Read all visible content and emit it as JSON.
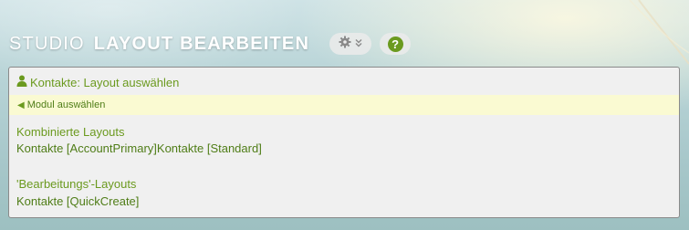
{
  "header": {
    "title_light": "STUDIO",
    "title_bold": "LAYOUT BEARBEITEN",
    "help_label": "?"
  },
  "panel": {
    "title": "Kontakte: Layout auswählen",
    "back_label": "Modul auswählen",
    "sections": [
      {
        "heading": "Kombinierte Layouts",
        "links": [
          "Kontakte [AccountPrimary]",
          "Kontakte [Standard]"
        ]
      },
      {
        "heading": "'Bearbeitungs'-Layouts",
        "links": [
          "Kontakte [QuickCreate]"
        ]
      }
    ]
  },
  "colors": {
    "accent_green": "#6b9a1f",
    "link_green": "#4f7d17",
    "nav_bar_bg": "#fafad2",
    "panel_bg": "#f0f0f0"
  },
  "icons": {
    "gear": "gear-icon",
    "dropdown": "double-chevron-down-icon",
    "help": "question-circle-icon",
    "user": "user-icon",
    "back": "triangle-left-icon"
  }
}
